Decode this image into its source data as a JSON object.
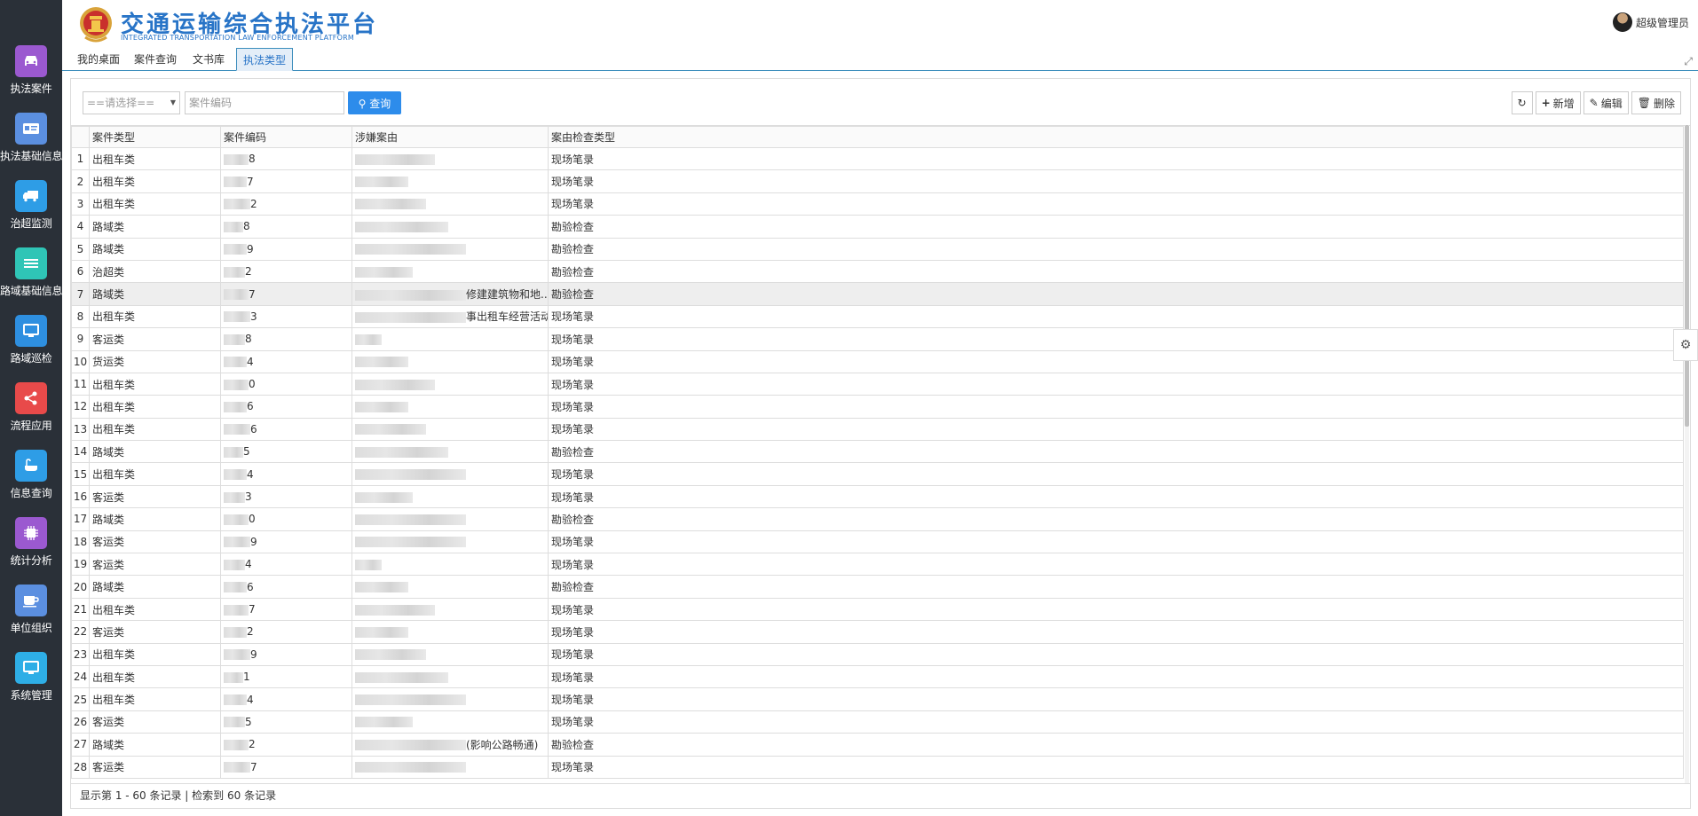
{
  "sidebar": {
    "items": [
      {
        "label": "执法案件",
        "icon": "car-icon",
        "color": "#9b59d0"
      },
      {
        "label": "执法基础信息",
        "icon": "id-card-icon",
        "color": "#5b8fe0"
      },
      {
        "label": "治超监测",
        "icon": "truck-icon",
        "color": "#2e9de6"
      },
      {
        "label": "路域基础信息",
        "icon": "list-icon",
        "color": "#2fc5b6"
      },
      {
        "label": "路域巡检",
        "icon": "monitor-icon",
        "color": "#2e8fe0"
      },
      {
        "label": "流程应用",
        "icon": "share-icon",
        "color": "#e84a4a"
      },
      {
        "label": "信息查询",
        "icon": "bath-icon",
        "color": "#2e9de6"
      },
      {
        "label": "统计分析",
        "icon": "chip-icon",
        "color": "#9b59d0"
      },
      {
        "label": "单位组织",
        "icon": "coffee-icon",
        "color": "#5b8fe0"
      },
      {
        "label": "系统管理",
        "icon": "monitor-icon",
        "color": "#2eaee6"
      }
    ]
  },
  "header": {
    "title_cn": "交通运输综合执法平台",
    "title_en": "INTEGRATED TRANSPORTATION LAW ENFORCEMENT PLATFORM",
    "user_name": "超级管理员"
  },
  "tabs": [
    {
      "label": "我的桌面",
      "active": false
    },
    {
      "label": "案件查询",
      "active": false
    },
    {
      "label": "文书库",
      "active": false
    },
    {
      "label": "执法类型",
      "active": true
    }
  ],
  "search": {
    "select_placeholder": "==请选择==",
    "input_placeholder": "案件编码",
    "query_label": "查询"
  },
  "toolbar": {
    "add_label": "新增",
    "edit_label": "编辑",
    "delete_label": "删除"
  },
  "table": {
    "columns": [
      "案件类型",
      "案件编码",
      "涉嫌案由",
      "案由检查类型"
    ],
    "rows": [
      {
        "n": "1",
        "type": "出租车类",
        "code": "8",
        "reason": "",
        "check": "现场笔录"
      },
      {
        "n": "2",
        "type": "出租车类",
        "code": "7",
        "reason": "",
        "check": "现场笔录"
      },
      {
        "n": "3",
        "type": "出租车类",
        "code": "2",
        "reason": "",
        "check": "现场笔录"
      },
      {
        "n": "4",
        "type": "路域类",
        "code": "8",
        "reason": "",
        "check": "勘验检查"
      },
      {
        "n": "5",
        "type": "路域类",
        "code": "9",
        "reason": "",
        "check": "勘验检查"
      },
      {
        "n": "6",
        "type": "治超类",
        "code": "2",
        "reason": "",
        "check": "勘验检查"
      },
      {
        "n": "7",
        "type": "路域类",
        "code": "7",
        "reason": "修建建筑物和地...",
        "check": "勘验检查"
      },
      {
        "n": "8",
        "type": "出租车类",
        "code": "3",
        "reason": "事出租车经营活动",
        "check": "现场笔录"
      },
      {
        "n": "9",
        "type": "客运类",
        "code": "8",
        "reason": "",
        "check": "现场笔录"
      },
      {
        "n": "10",
        "type": "货运类",
        "code": "4",
        "reason": "",
        "check": "现场笔录"
      },
      {
        "n": "11",
        "type": "出租车类",
        "code": "0",
        "reason": "",
        "check": "现场笔录"
      },
      {
        "n": "12",
        "type": "出租车类",
        "code": "6",
        "reason": "",
        "check": "现场笔录"
      },
      {
        "n": "13",
        "type": "出租车类",
        "code": "6",
        "reason": "",
        "check": "现场笔录"
      },
      {
        "n": "14",
        "type": "路域类",
        "code": "5",
        "reason": "",
        "check": "勘验检查"
      },
      {
        "n": "15",
        "type": "出租车类",
        "code": "4",
        "reason": "",
        "check": "现场笔录"
      },
      {
        "n": "16",
        "type": "客运类",
        "code": "3",
        "reason": "",
        "check": "现场笔录"
      },
      {
        "n": "17",
        "type": "路域类",
        "code": "0",
        "reason": "",
        "check": "勘验检查"
      },
      {
        "n": "18",
        "type": "客运类",
        "code": "9",
        "reason": "",
        "check": "现场笔录"
      },
      {
        "n": "19",
        "type": "客运类",
        "code": "4",
        "reason": "",
        "check": "现场笔录"
      },
      {
        "n": "20",
        "type": "路域类",
        "code": "6",
        "reason": "",
        "check": "勘验检查"
      },
      {
        "n": "21",
        "type": "出租车类",
        "code": "7",
        "reason": "",
        "check": "现场笔录"
      },
      {
        "n": "22",
        "type": "客运类",
        "code": "2",
        "reason": "",
        "check": "现场笔录"
      },
      {
        "n": "23",
        "type": "出租车类",
        "code": "9",
        "reason": "",
        "check": "现场笔录"
      },
      {
        "n": "24",
        "type": "出租车类",
        "code": "1",
        "reason": "",
        "check": "现场笔录"
      },
      {
        "n": "25",
        "type": "出租车类",
        "code": "4",
        "reason": "",
        "check": "现场笔录"
      },
      {
        "n": "26",
        "type": "客运类",
        "code": "5",
        "reason": "",
        "check": "现场笔录"
      },
      {
        "n": "27",
        "type": "路域类",
        "code": "2",
        "reason": "(影响公路畅通)",
        "check": "勘验检查"
      },
      {
        "n": "28",
        "type": "客运类",
        "code": "7",
        "reason": "",
        "check": "现场笔录"
      }
    ]
  },
  "footer": {
    "text": "显示第 1 - 60 条记录 | 检索到 60 条记录"
  },
  "colors": {
    "sidebar_bg": "#2a3038",
    "accent": "#2d8ceb",
    "title": "#2874c7"
  }
}
